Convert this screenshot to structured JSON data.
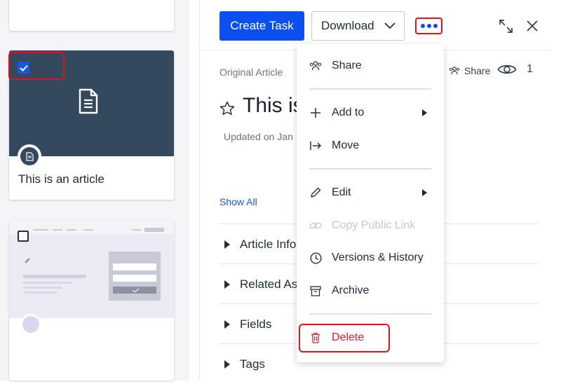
{
  "toolbar": {
    "create_task_label": "Create Task",
    "download_label": "Download"
  },
  "left": {
    "article_card_title": "This is an article"
  },
  "detail": {
    "subtitle": "Original Article",
    "share_label": "Share",
    "view_count": "1",
    "title": "This is",
    "updated": "Updated on Jan",
    "show_all": "Show All",
    "sections": [
      "Article Info",
      "Related As",
      "Fields",
      "Tags"
    ]
  },
  "menu": {
    "items": [
      {
        "label": "Share",
        "icon": "people-icon"
      },
      {
        "label": "Add to",
        "icon": "plus-icon",
        "submenu": true
      },
      {
        "label": "Move",
        "icon": "move-icon"
      },
      {
        "label": "Edit",
        "icon": "pencil-icon",
        "submenu": true
      },
      {
        "label": "Copy Public Link",
        "icon": "link-icon",
        "disabled": true
      },
      {
        "label": "Versions & History",
        "icon": "clock-icon"
      },
      {
        "label": "Archive",
        "icon": "archive-icon"
      },
      {
        "label": "Delete",
        "icon": "trash-icon",
        "danger": true
      }
    ]
  },
  "colors": {
    "primary": "#0b4ff0",
    "danger": "#e11d2d",
    "highlight": "#e3121a",
    "card_dark": "#34495e"
  }
}
